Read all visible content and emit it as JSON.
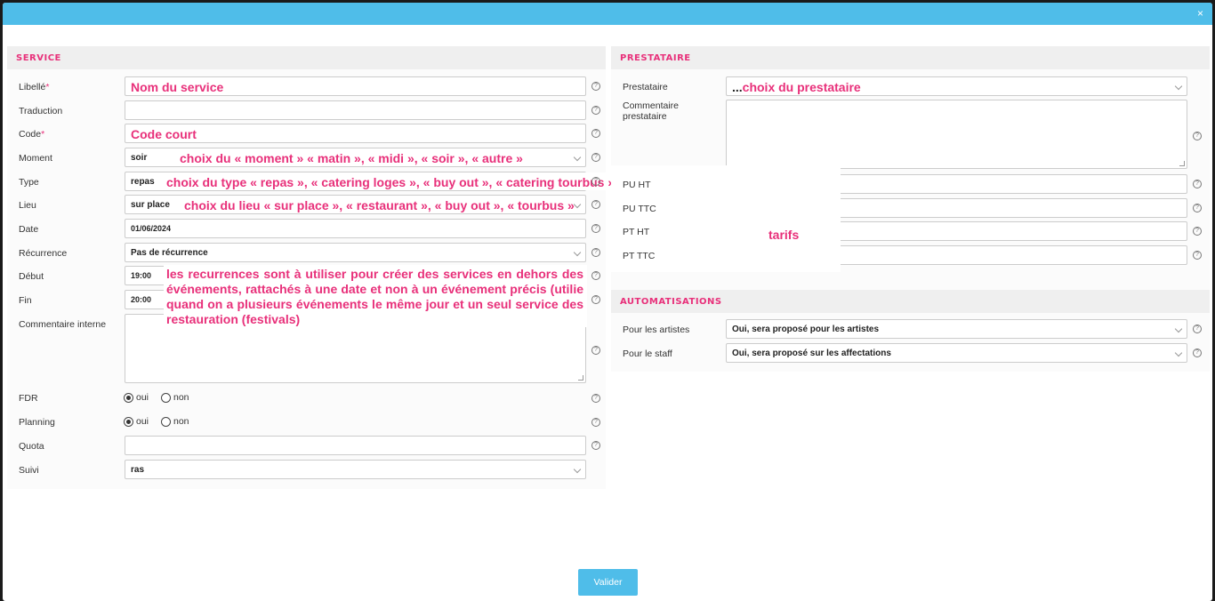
{
  "modal": {
    "close_label": "×"
  },
  "service": {
    "title": "SERVICE",
    "fields": {
      "libelle": {
        "label": "Libellé",
        "req": "*",
        "value": "Nom du service"
      },
      "traduction": {
        "label": "Traduction",
        "value": ""
      },
      "code": {
        "label": "Code",
        "req": "*",
        "value": "Code court"
      },
      "moment": {
        "label": "Moment",
        "value": "soir",
        "note": "choix du « moment » « matin », « midi », « soir », « autre »"
      },
      "type": {
        "label": "Type",
        "value": "repas",
        "note": "choix du type « repas », « catering loges », « buy out », « catering tourbus »"
      },
      "lieu": {
        "label": "Lieu",
        "value": "sur place",
        "note": "choix du lieu « sur place », « restaurant », « buy out », « tourbus »"
      },
      "date": {
        "label": "Date",
        "value": "01/06/2024"
      },
      "recurrence": {
        "label": "Récurrence",
        "value": "Pas de récurrence"
      },
      "debut": {
        "label": "Début",
        "value": "19:00"
      },
      "fin": {
        "label": "Fin",
        "value": "20:00"
      },
      "recurrence_note": "les recurrences sont à utiliser pour créer des services en dehors des événements, rattachés à une date et non à un événement précis (utilie quand on a plusieurs événements le même jour et un seul service des restauration (festivals)",
      "commentaire": {
        "label": "Commentaire interne",
        "value": ""
      },
      "fdr": {
        "label": "FDR",
        "opt_yes": "oui",
        "opt_no": "non",
        "selected": "oui"
      },
      "planning": {
        "label": "Planning",
        "opt_yes": "oui",
        "opt_no": "non",
        "selected": "oui"
      },
      "quota": {
        "label": "Quota",
        "value": ""
      },
      "suivi": {
        "label": "Suivi",
        "value": "ras"
      }
    }
  },
  "prestataire": {
    "title": "PRESTATAIRE",
    "fields": {
      "prestataire": {
        "label": "Prestataire",
        "prefix": "...",
        "value": "choix du prestataire"
      },
      "commentaire": {
        "label_line1": "Commentaire",
        "label_line2": "prestataire",
        "value": ""
      },
      "pu_ht": {
        "label": "PU HT",
        "value": ""
      },
      "pu_ttc": {
        "label": "PU TTC",
        "value": ""
      },
      "pt_ht": {
        "label": "PT HT",
        "value": ""
      },
      "pt_ttc": {
        "label": "PT TTC",
        "value": ""
      },
      "tarifs_note": "tarifs"
    }
  },
  "automatisations": {
    "title": "AUTOMATISATIONS",
    "fields": {
      "artistes": {
        "label": "Pour les artistes",
        "value": "Oui, sera proposé pour les artistes"
      },
      "staff": {
        "label": "Pour le staff",
        "value": "Oui, sera proposé sur les affectations"
      }
    }
  },
  "footer": {
    "submit_label": "Valider"
  },
  "colors": {
    "accent": "#4fbde9",
    "annotation": "#e8307a"
  },
  "icons": {
    "help": "question-circle-icon",
    "close": "close-icon",
    "dropdown": "chevron-down-icon"
  }
}
